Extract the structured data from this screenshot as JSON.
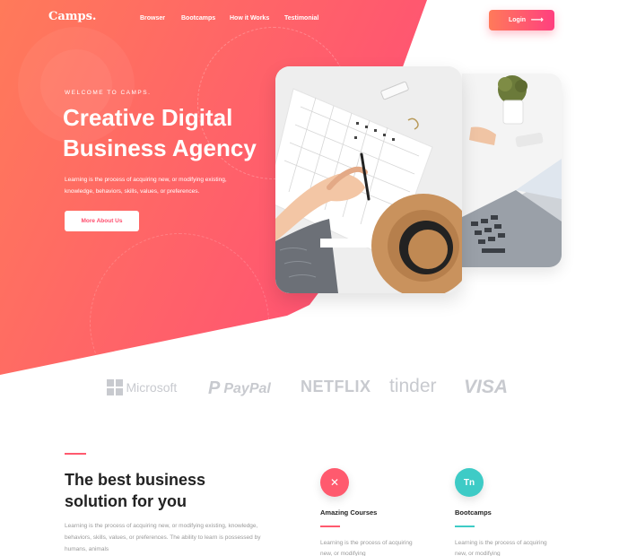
{
  "nav": {
    "logo": "Camps.",
    "links": [
      "Browser",
      "Bootcamps",
      "How it Works",
      "Testimonial"
    ],
    "login_label": "Login"
  },
  "hero": {
    "eyebrow": "WELCOME TO CAMPS.",
    "title": "Creative Digital Business Agency",
    "description": "Learning is the process of acquiring new, or modifying existing, knowledge, behaviors, skills, values, or preferences.",
    "cta_label": "More About Us"
  },
  "brands": [
    "Microsoft",
    "PayPal",
    "NETFLIX",
    "tinder",
    "VISA"
  ],
  "section": {
    "title": "The best business solution for you",
    "description": "Learning is the process of acquiring new, or modifying existing, knowledge, behaviors, skills, values, or preferences. The ability to learn is possessed by humans, animals"
  },
  "features": [
    {
      "title": "Amazing Courses",
      "icon": "tools-icon",
      "color": "#ff5a6e",
      "description": "Learning is the process of acquiring new, or modifying"
    },
    {
      "title": "Bootcamps",
      "icon": "tn-icon",
      "color": "#3ecbc6",
      "description": "Learning is the process of acquiring new, or modifying"
    }
  ],
  "colors": {
    "accent": "#ff5a6e",
    "teal": "#3ecbc6",
    "brand_gray": "#c8cacf"
  }
}
